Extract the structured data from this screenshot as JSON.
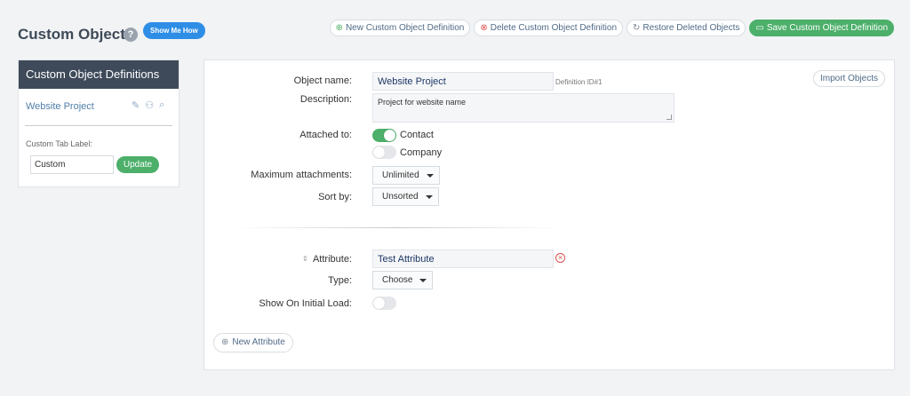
{
  "header": {
    "title": "Custom Objects",
    "help_icon": "?",
    "show_me_label": "Show Me How"
  },
  "actions": {
    "new_label": "New Custom Object Definition",
    "delete_label": "Delete Custom Object Definition",
    "restore_label": "Restore Deleted Objects",
    "save_label": "Save Custom Object Definition"
  },
  "sidebar": {
    "heading": "Custom Object Definitions",
    "item_label": "Website Project",
    "tab_label_caption": "Custom Tab Label:",
    "tab_label_value": "Custom",
    "update_label": "Update"
  },
  "form": {
    "object_name_label": "Object name:",
    "object_name_value": "Website Project",
    "definition_id": "Definition ID#1",
    "import_label": "Import Objects",
    "description_label": "Description:",
    "description_value": "Project for website name",
    "attached_label": "Attached to:",
    "attach_contact": "Contact",
    "attach_company": "Company",
    "max_label": "Maximum attachments:",
    "max_value": "Unlimited",
    "sort_label": "Sort by:",
    "sort_value": "Unsorted"
  },
  "attribute": {
    "attribute_label": "Attribute:",
    "attribute_value": "Test Attribute",
    "type_label": "Type:",
    "type_value": "Choose",
    "initial_load_label": "Show On Initial Load:",
    "new_attribute_label": "New Attribute"
  },
  "icons": {
    "help": "question-circle-icon",
    "add": "plus-circle-icon",
    "delete": "times-circle-icon",
    "restore": "refresh-icon",
    "save": "folder-icon",
    "edit": "pencil-icon",
    "user": "user-icon",
    "search": "search-icon",
    "drag": "drag-handle-icon",
    "remove": "remove-icon"
  },
  "colors": {
    "primary_green": "#4caf6a",
    "blue": "#2e8ee6",
    "sidebar_header": "#3e4a5a",
    "danger": "#d9534f"
  }
}
